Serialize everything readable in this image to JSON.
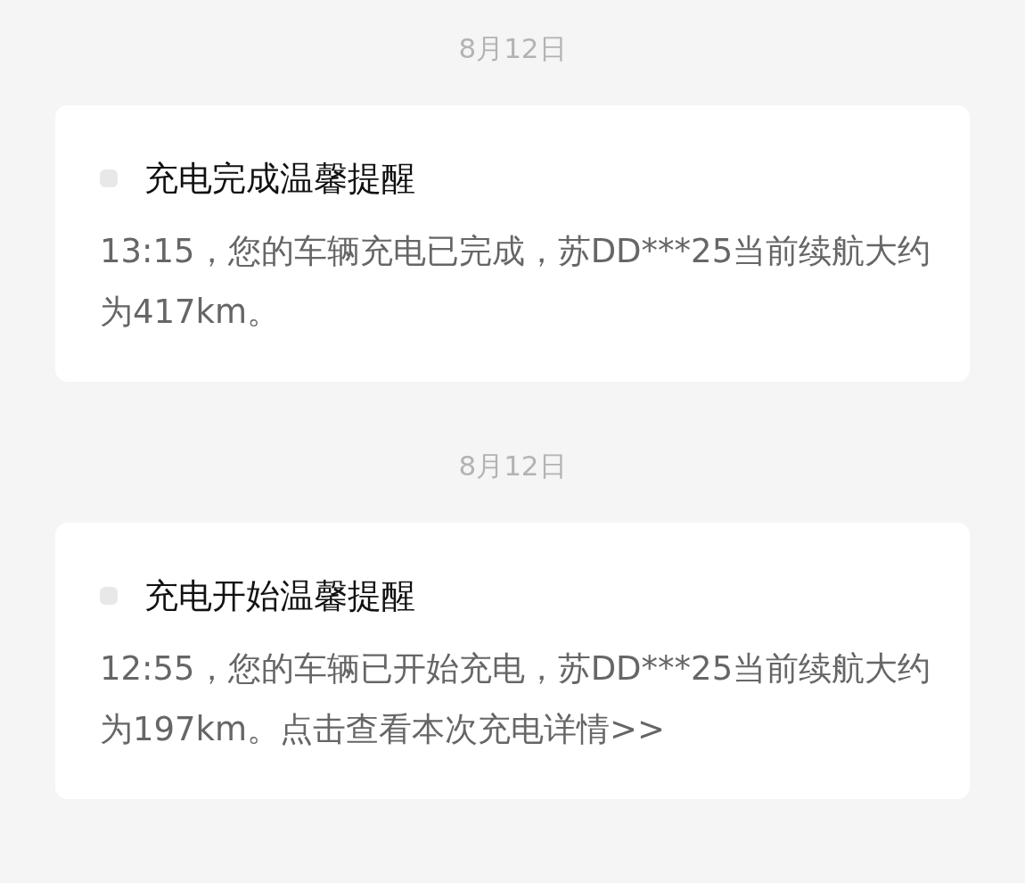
{
  "messages": [
    {
      "date": "8月12日",
      "title": "充电完成温馨提醒",
      "body": "13:15，您的车辆充电已完成，苏DD***25当前续航大约为417km。"
    },
    {
      "date": "8月12日",
      "title": "充电开始温馨提醒",
      "body": "12:55，您的车辆已开始充电，苏DD***25当前续航大约为197km。",
      "link": "点击查看本次充电详情>>"
    }
  ]
}
